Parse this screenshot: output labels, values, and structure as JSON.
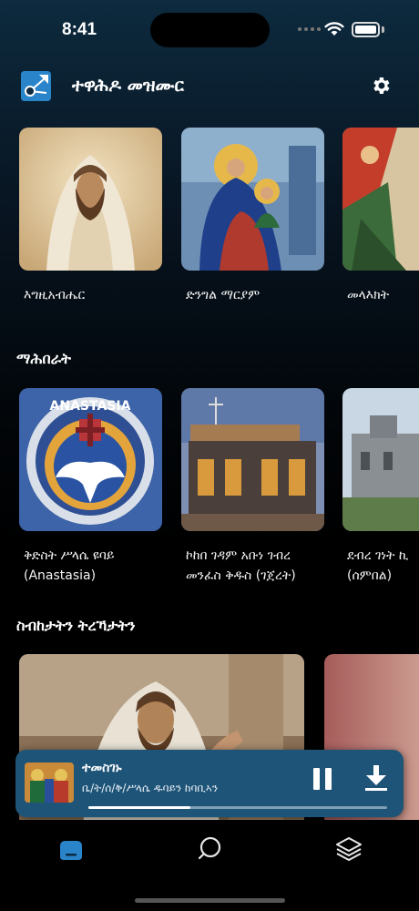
{
  "status_bar": {
    "time": "8:41"
  },
  "header": {
    "title": "ተዋሕዶ መዝሙር",
    "logo_icon": "app-logo-icon",
    "settings_icon": "gear-icon"
  },
  "categories": [
    {
      "label": "እግዚአብሔር",
      "image": "jesus-portrait"
    },
    {
      "label": "ድንግል ማርያም",
      "image": "virgin-mary-icon-painting"
    },
    {
      "label": "መላእክት",
      "image": "archangel-painting"
    }
  ],
  "mahberat": {
    "title": "ማሕበራት",
    "items": [
      {
        "line1": "ቅድስት ሥላሴ ዩባይ",
        "line2": "(Anastasia)",
        "image": "anastasia-emblem"
      },
      {
        "line1": "ኮከበ ገዳም አቡነ ገብረ",
        "line2": "መንፈስ ቅዱስ (ገጀረት)",
        "image": "stone-church"
      },
      {
        "line1": "ደብረ ገነት ኪ",
        "line2": "(ሰምበል)",
        "image": "church-building"
      }
    ],
    "emblem_text": "ANASTASIA"
  },
  "sermons": {
    "title": "ስብከታትን ትረኻታትን"
  },
  "player": {
    "title": "ተመስገኑ",
    "subtitle": "ቤ/ት/ሰ/ቅ/ሥላሴ ዱባይን ከባቢኣን",
    "progress": 0.34,
    "pause_icon": "pause-icon",
    "download_icon": "download-icon"
  },
  "nav": [
    {
      "name": "home",
      "icon": "home-icon",
      "active": true
    },
    {
      "name": "search",
      "icon": "search-icon",
      "active": false
    },
    {
      "name": "library",
      "icon": "layers-icon",
      "active": false
    }
  ],
  "colors": {
    "accent": "#2a84c9",
    "player_bg": "#1e5478",
    "background": "#000000"
  }
}
